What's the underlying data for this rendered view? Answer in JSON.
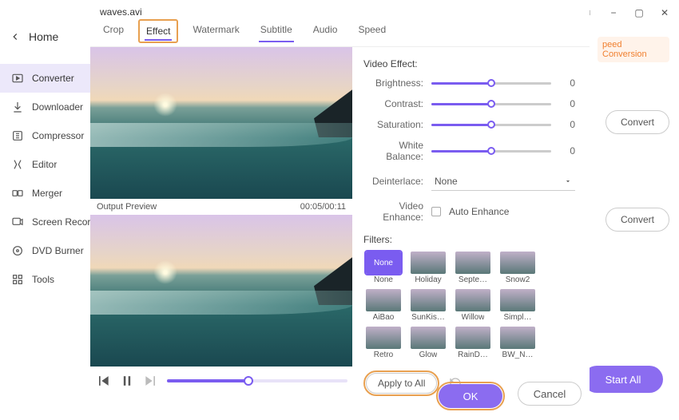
{
  "window": {
    "menu_icon": "≡",
    "min": "−",
    "max": "▢",
    "close": "✕"
  },
  "sidebar": {
    "home": "Home",
    "items": [
      {
        "label": "Converter"
      },
      {
        "label": "Downloader"
      },
      {
        "label": "Compressor"
      },
      {
        "label": "Editor"
      },
      {
        "label": "Merger"
      },
      {
        "label": "Screen Record"
      },
      {
        "label": "DVD Burner"
      },
      {
        "label": "Tools"
      }
    ]
  },
  "background": {
    "pill_label": "peed Conversion",
    "convert_label": "Convert",
    "start_all_label": "Start All"
  },
  "dialog": {
    "title": "waves.avi",
    "close": "✕",
    "tabs": [
      {
        "label": "Crop"
      },
      {
        "label": "Effect"
      },
      {
        "label": "Watermark"
      },
      {
        "label": "Subtitle"
      },
      {
        "label": "Audio"
      },
      {
        "label": "Speed"
      }
    ],
    "preview_label": "Output Preview",
    "time": "00:05/00:11",
    "effect": {
      "section": "Video Effect:",
      "sliders": [
        {
          "label": "Brightness:",
          "value": "0"
        },
        {
          "label": "Contrast:",
          "value": "0"
        },
        {
          "label": "Saturation:",
          "value": "0"
        },
        {
          "label": "White Balance:",
          "value": "0"
        }
      ],
      "deinterlace_label": "Deinterlace:",
      "deinterlace_value": "None",
      "enhance_label": "Video Enhance:",
      "enhance_checkbox": "Auto Enhance"
    },
    "filters": {
      "title": "Filters:",
      "items": [
        {
          "label": "None"
        },
        {
          "label": "Holiday"
        },
        {
          "label": "Septe…"
        },
        {
          "label": "Snow2"
        },
        {
          "label": "AiBao"
        },
        {
          "label": "SunKis…"
        },
        {
          "label": "Willow"
        },
        {
          "label": "Simpl…"
        },
        {
          "label": "Retro"
        },
        {
          "label": "Glow"
        },
        {
          "label": "RainD…"
        },
        {
          "label": "BW_N…"
        }
      ]
    },
    "apply_all": "Apply to All",
    "ok": "OK",
    "cancel": "Cancel"
  }
}
